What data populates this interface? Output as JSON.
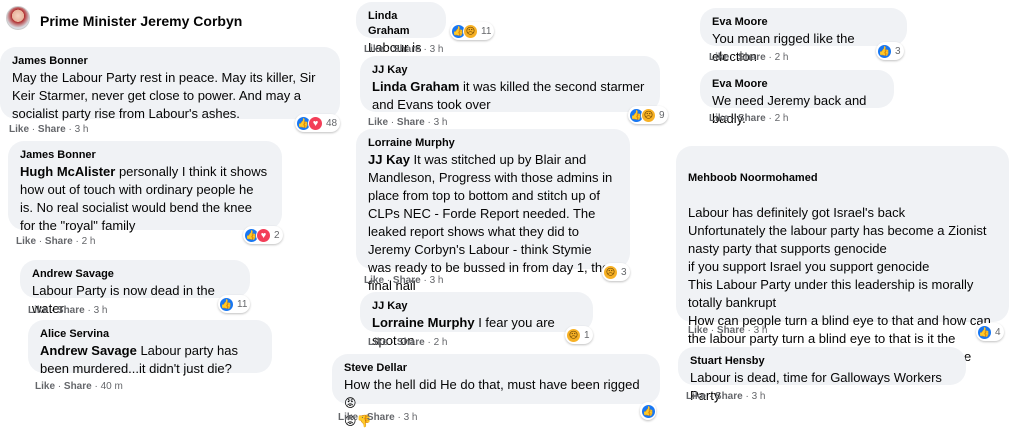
{
  "header": {
    "title": "Prime Minister Jeremy Corbyn"
  },
  "actions": {
    "like": "Like",
    "share": "Share",
    "sep": " · "
  },
  "col1": {
    "c1": {
      "author": "James Bonner",
      "text": "May the Labour Party rest in peace. May its killer, Sir Keir Starmer, never get close to power. And may a socialist party rise from Labour's ashes.",
      "time": "3 h",
      "count": "48"
    },
    "c2": {
      "author": "James Bonner",
      "mention": "Hugh McAlister",
      "text": " personally I think it shows how out of touch with ordinary people he is. No real socialist would bend the knee for the \"royal\" family",
      "time": "2 h",
      "count": "2"
    },
    "c3": {
      "author": "Andrew Savage",
      "text": "Labour Party is now dead in the water.",
      "time": "3 h",
      "count": "11"
    },
    "c4": {
      "author": "Alice Servina",
      "mention": "Andrew Savage",
      "text": " Labour party has been murdered...it didn't just die?",
      "time": "40 m"
    }
  },
  "col2": {
    "c1": {
      "author": "Linda Graham",
      "text": "Labour is dead",
      "time": "3 h",
      "count": "11"
    },
    "c2": {
      "author": "JJ Kay",
      "mention": "Linda Graham",
      "text": " it was killed the second starmer and Evans took over",
      "time": "3 h",
      "count": "9"
    },
    "c3": {
      "author": "Lorraine Murphy",
      "mention": "JJ Kay",
      "text": " It was stitched up by Blair and Mandleson, Progress with those admins in place from top to bottom and stitch up of CLPs NEC - Forde Report needed. The leaked report shows what they did to Jeremy Corbyn's Labour - think Stymie was ready to be bussed in from day 1, the final nail",
      "time": "3 h",
      "count": "3"
    },
    "c4": {
      "author": "JJ Kay",
      "mention": "Lorraine Murphy",
      "text": " I fear you are spot on",
      "time": "2 h",
      "count": "1"
    },
    "c5": {
      "author": "Steve Dellar",
      "text": "How the hell did He do that, must have been rigged",
      "time": "3 h"
    }
  },
  "col3": {
    "c1": {
      "author": "Eva Moore",
      "text": "You mean rigged like the election",
      "time": "2 h",
      "count": "3"
    },
    "c2": {
      "author": "Eva Moore",
      "text": "We need Jeremy back and badly.",
      "time": "2 h"
    },
    "c3": {
      "author": "Mehboob Noormohamed",
      "text": "Labour has definitely got Israel's back\nUnfortunately the labour party has become a Zionist nasty party that supports genocide\nif you support Israel you support genocide\nThis Labour Party under this leadership is morally totally bankrupt\nHow can people turn a blind eye to that and how can the labour party turn a blind eye to that is it the money there after from the Israeli lobby the same thing was",
      "time": "3 h",
      "count": "4"
    },
    "c4": {
      "author": "Stuart Hensby",
      "text": "Labour is dead, time for Galloways Workers Party",
      "time": "3 h"
    }
  },
  "icons": {
    "like": "like-icon",
    "love": "love-icon",
    "sad": "sad-icon",
    "angry": "angry-icon"
  }
}
